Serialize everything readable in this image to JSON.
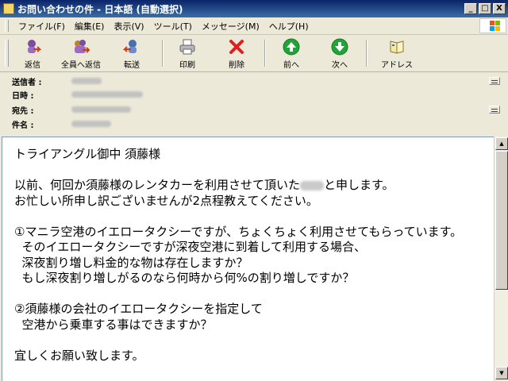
{
  "window": {
    "title": "お問い合わせの件 - 日本語 (自動選択)",
    "controls": {
      "minimize": "_",
      "maximize": "□",
      "close": "X"
    }
  },
  "menu": [
    "ファイル(F)",
    "編集(E)",
    "表示(V)",
    "ツール(T)",
    "メッセージ(M)",
    "ヘルプ(H)"
  ],
  "toolbar": {
    "reply": "返信",
    "reply_all": "全員へ返信",
    "forward": "転送",
    "print": "印刷",
    "delete": "削除",
    "previous": "前へ",
    "next": "次へ",
    "addresses": "アドレス"
  },
  "headers": {
    "from_label": "送信者 :",
    "date_label": "日時 :",
    "to_label": "宛先 :",
    "subject_label": "件名 :"
  },
  "body": {
    "line1": "トライアングル御中 須藤様",
    "line2_pre": "以前、何回か須藤様のレンタカーを利用させて頂いた",
    "line2_post": "と申します。",
    "line3": "お忙しい所申し訳ございませんが2点程教えてください。",
    "line4": "①マニラ空港のイエロータクシーですが、ちょくちょく利用させてもらっています。",
    "line5": "  そのイエロータクシーですが深夜空港に到着して利用する場合、",
    "line6": "  深夜割り増し料金的な物は存在しますか？",
    "line7": "  もし深夜割り増しがるのなら何時から何%の割り増しですか？",
    "line8": "②須藤様の会社のイエロータクシーを指定して",
    "line9": "  空港から乗車する事はできますか？",
    "line10": "宜しくお願い致します。"
  },
  "colors": {
    "titlebar": "#0a246a",
    "delete_red": "#e02020",
    "nav_green": "#22a33a",
    "chrome": "#ece9d8"
  }
}
